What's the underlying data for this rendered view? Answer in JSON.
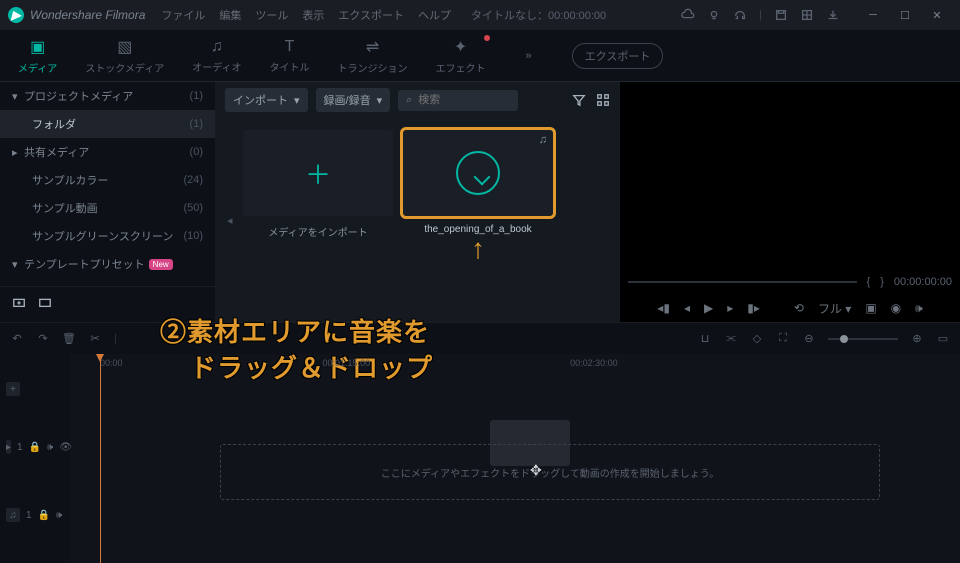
{
  "app": {
    "name": "Wondershare Filmora"
  },
  "menu": [
    "ファイル",
    "編集",
    "ツール",
    "表示",
    "エクスポート",
    "ヘルプ"
  ],
  "title": "タイトルなし：00:00:00:00",
  "tabs": [
    {
      "label": "メディア",
      "active": true
    },
    {
      "label": "ストックメディア"
    },
    {
      "label": "オーディオ"
    },
    {
      "label": "タイトル"
    },
    {
      "label": "トランジション"
    },
    {
      "label": "エフェクト",
      "dot": true
    }
  ],
  "export_btn": "エクスポート",
  "sidebar": [
    {
      "label": "プロジェクトメディア",
      "count": "(1)",
      "arrow": "▾"
    },
    {
      "label": "フォルダ",
      "count": "(1)",
      "sel": true,
      "ind": true
    },
    {
      "label": "共有メディア",
      "count": "(0)",
      "arrow": "▸"
    },
    {
      "label": "サンプルカラー",
      "count": "(24)",
      "ind": true
    },
    {
      "label": "サンプル動画",
      "count": "(50)",
      "ind": true
    },
    {
      "label": "サンプルグリーンスクリーン",
      "count": "(10)",
      "ind": true
    },
    {
      "label": "テンプレートプリセット",
      "arrow": "▾",
      "new": true
    }
  ],
  "toolbar": {
    "import": "インポート",
    "record": "録画/録音",
    "search_ph": "検索"
  },
  "cards": {
    "import": "メディアをインポート",
    "file": "the_opening_of_a_book"
  },
  "annotation": {
    "arrow": "↑",
    "line1": "②素材エリアに音楽を",
    "line2": "ドラッグ＆ドロップ"
  },
  "preview": {
    "time": "00:00:00:00",
    "fit": "フル"
  },
  "ruler": [
    "00:00",
    "00:01:15:00",
    "00:02:30:00"
  ],
  "dropzone": "ここにメディアやエフェクトをドラッグして動画の作成を開始しましょう。"
}
